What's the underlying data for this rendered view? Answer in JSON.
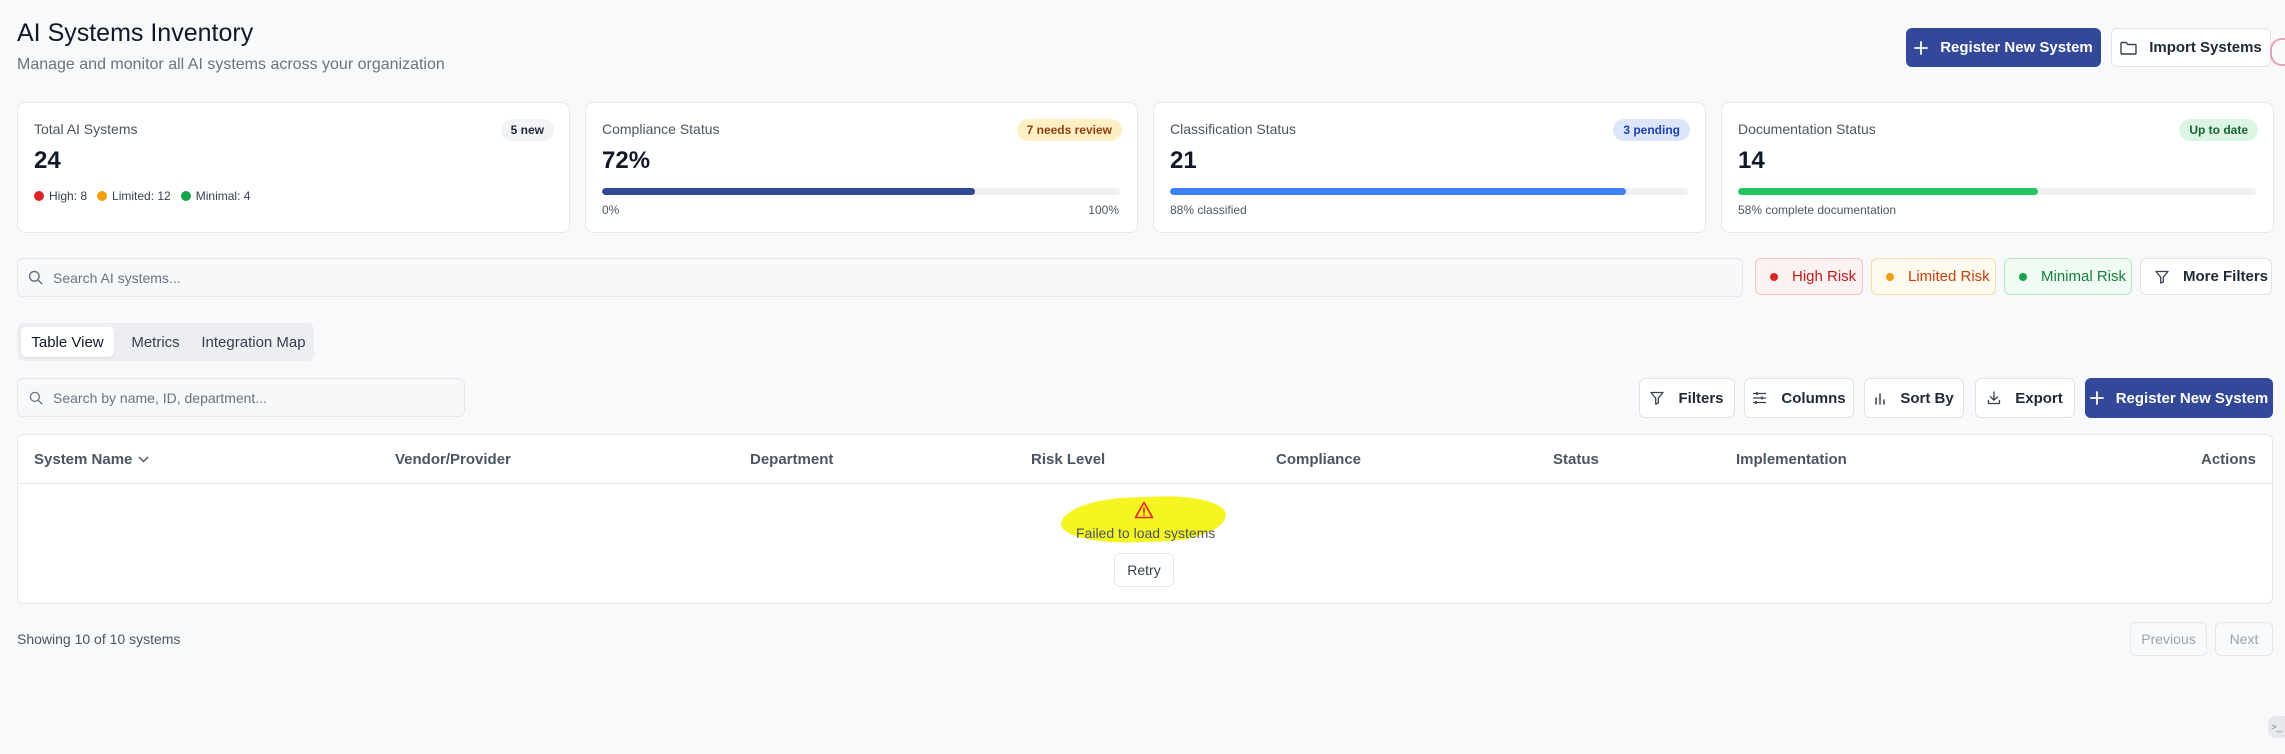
{
  "header": {
    "title": "AI Systems Inventory",
    "subtitle": "Manage and monitor all AI systems across your organization",
    "register_label": "Register New System",
    "import_label": "Import Systems"
  },
  "cards": {
    "total": {
      "title": "Total AI Systems",
      "badge": "5 new",
      "value": "24",
      "legend": [
        {
          "label": "High: 8",
          "color": "#dc2626"
        },
        {
          "label": "Limited: 12",
          "color": "#f59e0b"
        },
        {
          "label": "Minimal: 4",
          "color": "#16a34a"
        }
      ]
    },
    "compliance": {
      "title": "Compliance Status",
      "badge": "7 needs review",
      "value": "72%",
      "progress": 0.72,
      "min_label": "0%",
      "max_label": "100%",
      "bar_color": "#34489a"
    },
    "classification": {
      "title": "Classification Status",
      "badge": "3 pending",
      "value": "21",
      "progress": 0.88,
      "foot": "88% classified",
      "bar_color": "#3b82f6"
    },
    "documentation": {
      "title": "Documentation Status",
      "badge": "Up to date",
      "value": "14",
      "progress": 0.58,
      "foot": "58% complete documentation",
      "bar_color": "#22c55e"
    }
  },
  "search": {
    "placeholder": "Search AI systems..."
  },
  "risk_filters": {
    "high": "High Risk",
    "limited": "Limited Risk",
    "minimal": "Minimal Risk",
    "more": "More Filters"
  },
  "tabs": [
    "Table View",
    "Metrics",
    "Integration Map"
  ],
  "toolbar": {
    "search_placeholder": "Search by name, ID, department...",
    "filters": "Filters",
    "columns": "Columns",
    "sort_by": "Sort By",
    "export": "Export",
    "register": "Register New System"
  },
  "table": {
    "columns": [
      "System Name",
      "Vendor/Provider",
      "Department",
      "Risk Level",
      "Compliance",
      "Status",
      "Implementation",
      "Actions"
    ],
    "error_message": "Failed to load systems",
    "retry_label": "Retry"
  },
  "footer": {
    "showing": "Showing 10 of 10 systems",
    "previous": "Previous",
    "next": "Next"
  },
  "colors": {
    "primary": "#34489a",
    "high": "#dc2626",
    "limited": "#f59e0b",
    "minimal": "#16a34a"
  }
}
